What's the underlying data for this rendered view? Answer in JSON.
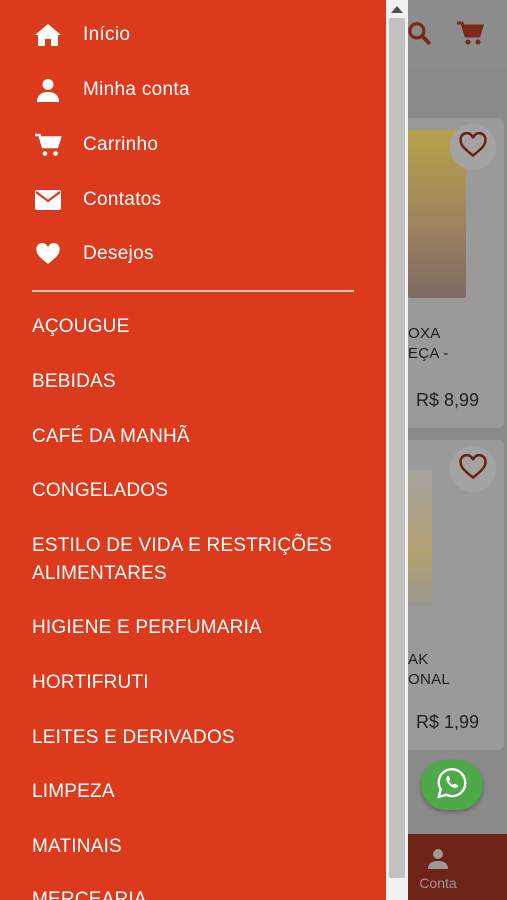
{
  "nav": {
    "items": [
      {
        "label": "Início",
        "icon": "home-icon"
      },
      {
        "label": "Minha conta",
        "icon": "user-icon"
      },
      {
        "label": "Carrinho",
        "icon": "cart-icon"
      },
      {
        "label": "Contatos",
        "icon": "envelope-icon"
      },
      {
        "label": "Desejos",
        "icon": "heart-icon"
      }
    ]
  },
  "categories": [
    "AÇOUGUE",
    "BEBIDAS",
    "CAFÉ DA MANHÃ",
    "CONGELADOS",
    "ESTILO DE VIDA E RESTRIÇÕES ALIMENTARES",
    "HIGIENE E PERFUMARIA",
    "HORTIFRUTI",
    "LEITES E DERIVADOS",
    "LIMPEZA",
    "MATINAIS",
    "MERCEARIA"
  ],
  "background": {
    "products": [
      {
        "name_line1": "OXA",
        "name_line2": "EÇA -",
        "price": "R$ 8,99"
      },
      {
        "name_line1": "AK",
        "name_line2": "ONAL",
        "price": "R$ 1,99"
      }
    ],
    "bottom_tab_label": "Conta"
  },
  "colors": {
    "drawer": "#dc3a1d",
    "whatsapp": "#4eaa49"
  }
}
